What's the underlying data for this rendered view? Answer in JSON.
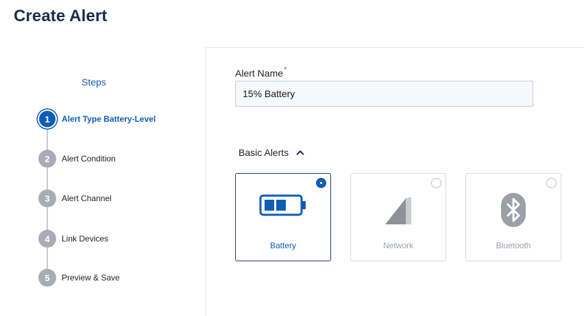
{
  "page": {
    "title": "Create Alert"
  },
  "steps": {
    "heading": "Steps",
    "items": [
      {
        "number": "1",
        "label": "Alert Type Battery-Level",
        "active": true
      },
      {
        "number": "2",
        "label": "Alert Condition",
        "active": false
      },
      {
        "number": "3",
        "label": "Alert Channel",
        "active": false
      },
      {
        "number": "4",
        "label": "Link Devices",
        "active": false
      },
      {
        "number": "5",
        "label": "Preview & Save",
        "active": false
      }
    ]
  },
  "form": {
    "alert_name_label": "Alert Name",
    "required_marker": "*",
    "alert_name_value": "15% Battery"
  },
  "basic_alerts": {
    "label": "Basic Alerts",
    "expanded": true,
    "cards": [
      {
        "label": "Battery",
        "icon": "battery-icon",
        "selected": true
      },
      {
        "label": "Network",
        "icon": "network-signal-icon",
        "selected": false
      },
      {
        "label": "Bluetooth",
        "icon": "bluetooth-icon",
        "selected": false
      }
    ]
  },
  "colors": {
    "accent": "#0f5db6",
    "title": "#1c2b4a",
    "step_inactive": "#a8adb5",
    "required": "#d33b2c"
  }
}
